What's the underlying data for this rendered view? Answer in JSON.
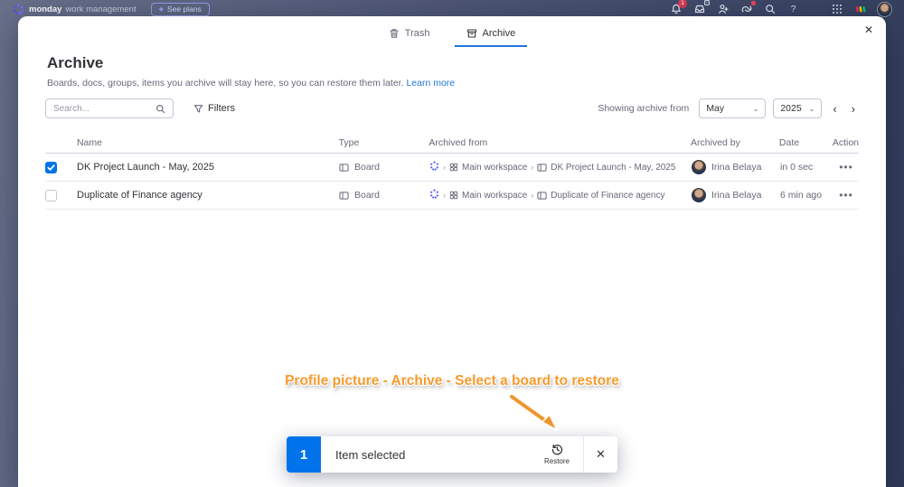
{
  "header": {
    "brand": "monday",
    "brand_suffix": "work management",
    "see_plans_label": "See plans",
    "notification_count": "1"
  },
  "icons": {
    "question": "?",
    "close": "✕",
    "chevron_down": "⌄",
    "chevron_left": "‹",
    "chevron_right": "›",
    "crumb_sep": "›",
    "more": "•••",
    "diamond": "◈"
  },
  "modal": {
    "tabs": [
      {
        "label": "Trash",
        "active": false
      },
      {
        "label": "Archive",
        "active": true
      }
    ],
    "title": "Archive",
    "description": "Boards, docs, groups, items you archive will stay here, so you can restore them later.",
    "learn_more": "Learn more",
    "search_placeholder": "Search...",
    "filters_label": "Filters",
    "showing_label": "Showing archive from",
    "month": "May",
    "year": "2025",
    "table": {
      "columns": [
        "Name",
        "Type",
        "Archived from",
        "Archived by",
        "Date",
        "Action"
      ],
      "rows": [
        {
          "checked": true,
          "name": "DK Project Launch - May, 2025",
          "type": "Board",
          "workspace": "Main workspace",
          "board": "DK Project Launch - May, 2025",
          "archived_by": "Irina Belaya",
          "date": "in 0 sec"
        },
        {
          "checked": false,
          "name": "Duplicate of Finance agency",
          "type": "Board",
          "workspace": "Main workspace",
          "board": "Duplicate of Finance agency",
          "archived_by": "Irina Belaya",
          "date": "6 min ago"
        }
      ]
    }
  },
  "annotation": {
    "text": "Profile picture - Archive - Select a board to restore"
  },
  "toolbar": {
    "count": "1",
    "label": "Item selected",
    "restore_label": "Restore"
  },
  "colors": {
    "accent": "#0073ea",
    "tab_underline": "#1f76db",
    "annotation_orange": "#f59b2d",
    "badge_red": "#d83a52"
  }
}
